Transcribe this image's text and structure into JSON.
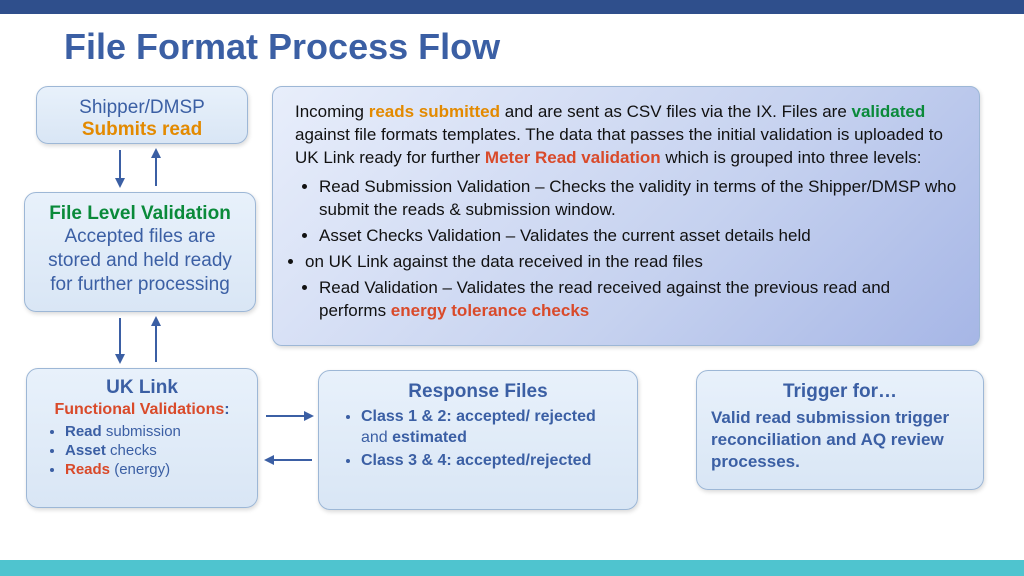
{
  "title": "File Format Process Flow",
  "box1": {
    "l1": "Shipper/DMSP",
    "l2": "Submits read"
  },
  "box2": {
    "l1": "File Level Validation",
    "l2": "Accepted files are stored and held ready for further processing"
  },
  "box3": {
    "hd": "UK Link",
    "fv": "Functional Validations",
    "colon": ":",
    "items": [
      {
        "bold": "Read",
        "rest": " submission"
      },
      {
        "bold": "Asset",
        "rest": " checks"
      },
      {
        "red": "Reads ",
        "paren": "(energy)"
      }
    ]
  },
  "info": {
    "p1a": "Incoming ",
    "p1b": "reads submitted",
    "p1c": " and are sent as CSV files via the IX. Files  are ",
    "p1d": "validated",
    "p1e": " against file formats templates. The data that passes the  initial validation is uploaded to UK Link ready for further ",
    "p1f": "Meter Read  validation",
    "p1g": " which is grouped into three levels:",
    "bullets": [
      "Read Submission Validation – Checks the validity in terms of the Shipper/DMSP who submit the reads & submission window.",
      "Asset Checks Validation – Validates the current asset details held",
      "on UK Link against the data received in the read files"
    ],
    "b4a": "Read Validation – Validates the read received against the previous read and performs ",
    "b4b": "energy tolerance checks"
  },
  "box4": {
    "hd": "Response Files",
    "items": [
      {
        "b": "Class 1 & 2: accepted/ rejected ",
        "n": "and",
        "b2": " estimated"
      },
      {
        "b": "Class 3 & 4: accepted/rejected"
      }
    ]
  },
  "box5": {
    "hd": "Trigger for…",
    "body": "Valid read submission trigger reconciliation and AQ review processes."
  }
}
